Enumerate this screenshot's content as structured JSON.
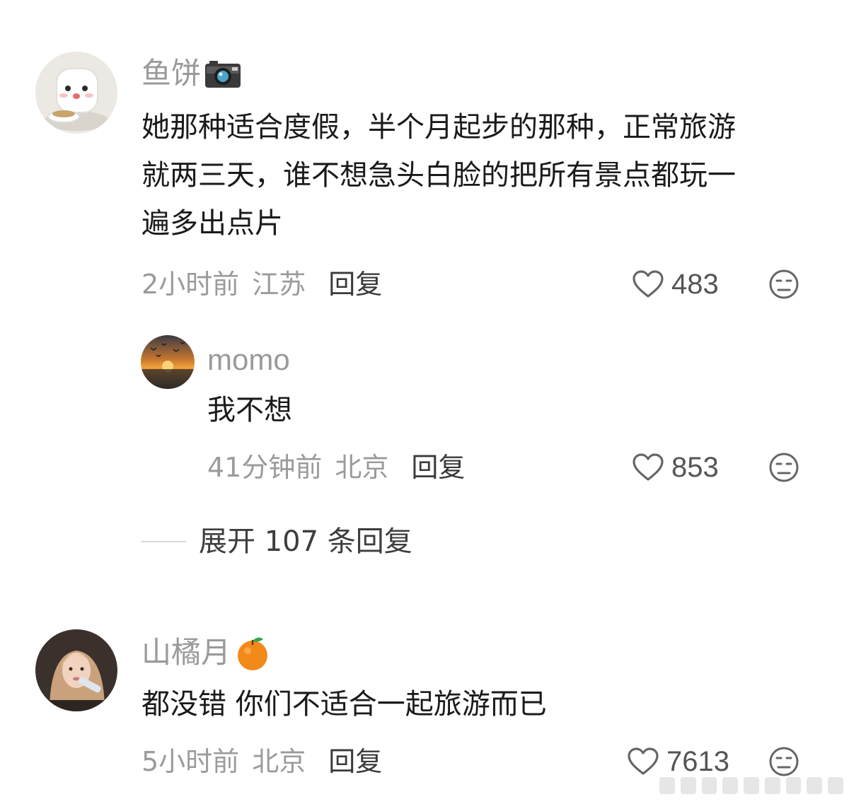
{
  "comments": [
    {
      "username": "鱼饼",
      "badge_icon": "camera-icon",
      "text_lines": [
        "她那种适合度假，半个月起步的那种，正常旅游",
        "就两三天，谁不想急头白脸的把所有景点都玩一",
        "遍多出点片"
      ],
      "time": "2小时前",
      "location": "江苏",
      "reply_label": "回复",
      "likes": "483"
    },
    {
      "username": "momo",
      "is_reply": true,
      "text_lines": [
        "我不想"
      ],
      "time": "41分钟前",
      "location": "北京",
      "reply_label": "回复",
      "likes": "853"
    },
    {
      "username": "山橘月",
      "badge_icon": "orange-icon",
      "text_lines": [
        "都没错 你们不适合一起旅游而已"
      ],
      "time": "5小时前",
      "location": "北京",
      "reply_label": "回复",
      "likes": "7613"
    }
  ],
  "expand_replies": {
    "label": "展开 107 条回复"
  },
  "icons": {
    "like": "heart-outline-icon",
    "dislike": "unamused-face-icon"
  },
  "colors": {
    "username": "#9a9a9a",
    "body_text": "#1a1a1a",
    "meta_text": "#9b9b9b",
    "reply_label": "#3a3a3a",
    "icon_gray": "#666666",
    "orange": "#f28a1a"
  }
}
